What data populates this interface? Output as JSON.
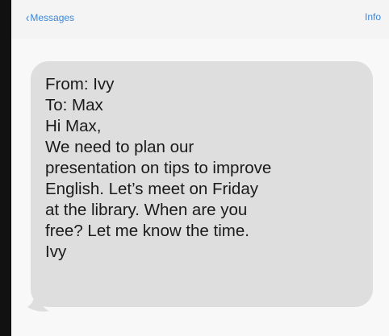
{
  "nav": {
    "back_label": "Messages",
    "info_label": "Info"
  },
  "icons": {
    "back": "chevron-left-icon"
  },
  "colors": {
    "accent": "#3b86d8",
    "bubble": "#dedede",
    "bezel": "#111111"
  },
  "message": {
    "lines": [
      "From: Ivy",
      "To: Max",
      "Hi Max,",
      "We need to plan our",
      "presentation on tips to improve",
      "English. Let’s meet on Friday",
      "at the library. When are you",
      "free? Let me know the time.",
      "Ivy"
    ]
  }
}
